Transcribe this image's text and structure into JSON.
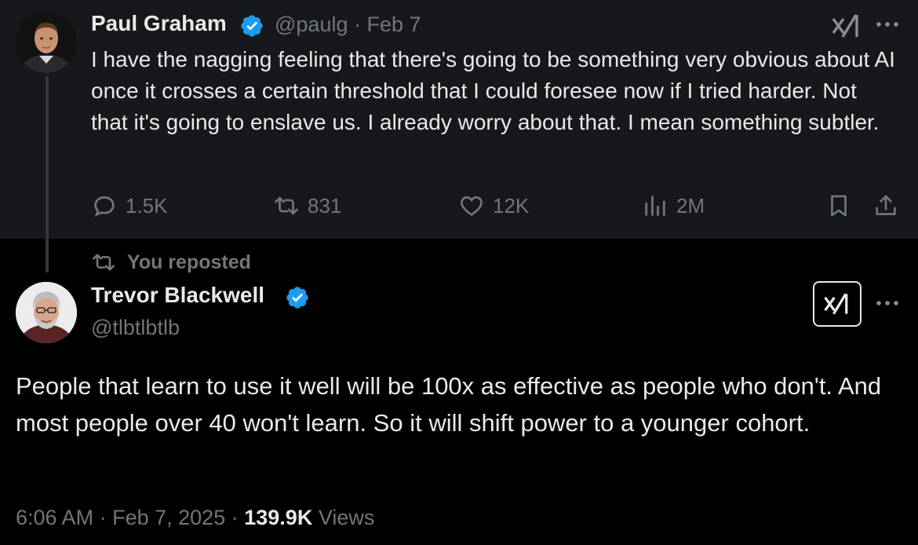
{
  "parent_tweet": {
    "author_name": "Paul Graham",
    "handle": "@paulg",
    "separator": "·",
    "date": "Feb 7",
    "text": "I have the nagging feeling that there's going to be something very obvious about AI once it crosses a certain threshold that I could foresee now if I tried harder. Not that it's going to enslave us. I already worry about that. I mean something subtler.",
    "actions": {
      "replies": "1.5K",
      "reposts": "831",
      "likes": "12K",
      "views": "2M"
    }
  },
  "repost_banner": {
    "label": "You reposted"
  },
  "main_tweet": {
    "author_name": "Trevor Blackwell",
    "handle": "@tlbtlbtlb",
    "text": "People that learn to use it well will be 100x as effective as people who don't. And most people over 40 won't learn. So it will shift power to a younger cohort.",
    "time": "6:06 AM",
    "separator": "·",
    "date": "Feb 7, 2025",
    "separator2": "·",
    "views_count": "139.9K",
    "views_label": "Views"
  },
  "colors": {
    "background": "#000000",
    "parent_background": "#16181c",
    "text": "#e7e9ea",
    "muted": "#71767b",
    "verified": "#1d9bf0"
  },
  "icons": [
    "verified-badge-icon",
    "grok-icon",
    "more-icon",
    "reply-icon",
    "repost-icon",
    "like-icon",
    "views-icon",
    "bookmark-icon",
    "share-icon"
  ]
}
